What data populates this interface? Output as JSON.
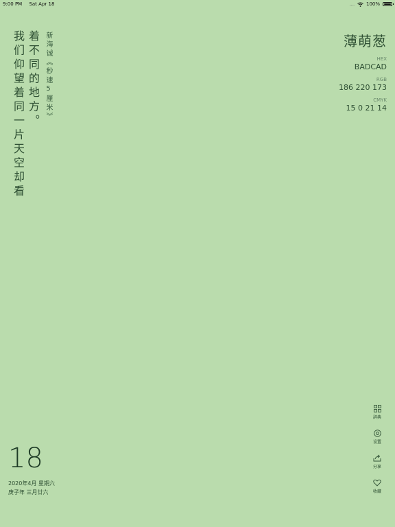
{
  "status_bar": {
    "time": "9:00 PM",
    "date": "Sat Apr 18",
    "signal": "....",
    "battery": "100%"
  },
  "poem": {
    "line1": "我们仰望着同一片天空却看",
    "line2": "着不同的地方。",
    "source": "新海诚《秒速5厘米》"
  },
  "color": {
    "name": "薄萌葱",
    "hex_label": "HEX",
    "hex_value": "BADCAD",
    "rgb_label": "RGB",
    "rgb_value": "186 220 173",
    "cmyk_label": "CMYK",
    "cmyk_value": "15 0 21 14",
    "background": "#BADCAD",
    "text_color": "#2E4F33"
  },
  "date": {
    "day": "18",
    "gregorian": "2020年4月 星期六",
    "lunar": "庚子年 三月廿六"
  },
  "menu": {
    "dictionary": "辞典",
    "settings": "设置",
    "share": "分享",
    "favorite": "收藏"
  }
}
